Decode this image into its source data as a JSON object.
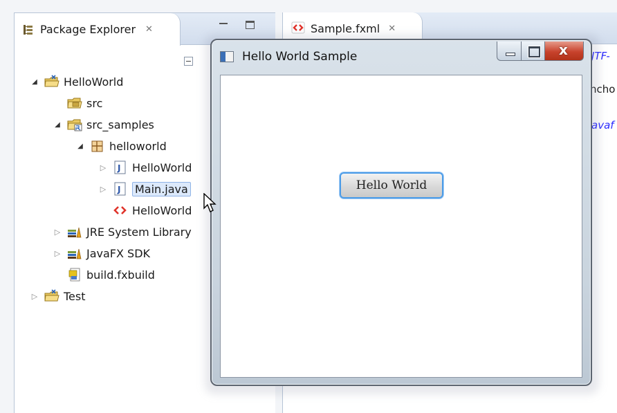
{
  "package_explorer": {
    "tab_label": "Package Explorer",
    "close_glyph": "✕",
    "tree": [
      {
        "label": "HelloWorld",
        "icon": "project-folder-icon",
        "twisty": "▲",
        "indent": 0
      },
      {
        "label": "src",
        "icon": "source-folder-icon",
        "twisty": "",
        "indent": 1
      },
      {
        "label": "src_samples",
        "icon": "source-folder-linked-icon",
        "twisty": "▲",
        "indent": 1
      },
      {
        "label": "helloworld",
        "icon": "package-icon",
        "twisty": "▲",
        "indent": 2
      },
      {
        "label": "HelloWorld",
        "icon": "java-file-icon",
        "twisty": "▷",
        "indent": 3
      },
      {
        "label": "Main.java",
        "icon": "java-file-icon",
        "twisty": "▷",
        "indent": 3,
        "selected": true
      },
      {
        "label": "HelloWorld",
        "icon": "fxml-file-icon",
        "twisty": "",
        "indent": 3
      },
      {
        "label": "JRE System Library",
        "icon": "library-icon",
        "twisty": "▷",
        "indent": 1
      },
      {
        "label": "JavaFX SDK",
        "icon": "library-icon",
        "twisty": "▷",
        "indent": 1
      },
      {
        "label": "build.fxbuild",
        "icon": "build-file-icon",
        "twisty": "",
        "indent": 1
      },
      {
        "label": "Test",
        "icon": "project-folder-icon",
        "twisty": "▷",
        "indent": 0
      }
    ]
  },
  "editor": {
    "tab_label": "Sample.fxml",
    "close_glyph": "✕",
    "fragments": {
      "line1": "JTF-",
      "line2": "ncho",
      "line3": "avaf"
    }
  },
  "app_window": {
    "title": "Hello World Sample",
    "button_label": "Hello World"
  },
  "colors": {
    "selection": "#dce9fb",
    "focus_border": "#4a9be8",
    "close_button": "#c8432d"
  }
}
